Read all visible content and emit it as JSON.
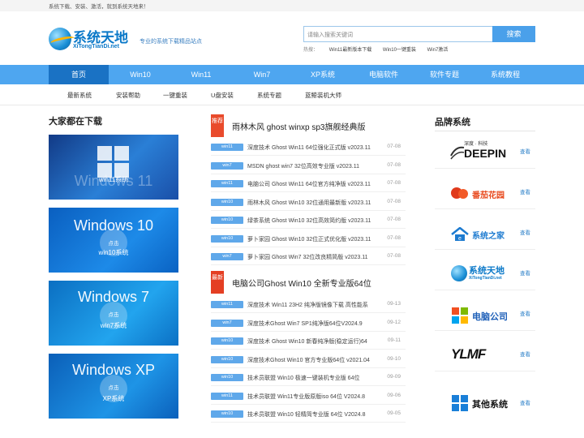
{
  "topbar": {
    "text": "系统下载、安装、激活，就到系统天地来！"
  },
  "header": {
    "logo_cn": "系统天地",
    "logo_en": "XiTongTianDi.net",
    "slogan": "专业的系统下载精品站点",
    "search_placeholder": "请输入搜索关键词",
    "search_button": "搜索",
    "hot_label": "热搜：",
    "hot_links": [
      "Win11最新版本下载",
      "Win10一键重装",
      "Win7激活"
    ]
  },
  "nav": {
    "items": [
      "首页",
      "Win10",
      "Win11",
      "Win7",
      "XP系统",
      "电脑软件",
      "软件专题",
      "系统教程"
    ]
  },
  "subnav": {
    "items": [
      "最新系统",
      "安装帮助",
      "一键重装",
      "U盘安装",
      "系统专题",
      "蓝鲸装机大师"
    ]
  },
  "left": {
    "title": "大家都在下载",
    "cards": [
      {
        "big": "Windows 11",
        "label": "win11系统"
      },
      {
        "big": "Windows 10",
        "label": "win10系统",
        "circle": "点击"
      },
      {
        "big": "Windows 7",
        "label": "win7系统",
        "circle": "点击"
      },
      {
        "big": "Windows XP",
        "label": "XP系统",
        "circle": "点击"
      }
    ]
  },
  "middle": {
    "groups": [
      {
        "badge": "推荐",
        "title": "雨林木风 ghost winxp sp3旗舰经典版",
        "rows": [
          {
            "tag": "win11",
            "title": "深度技术 Ghost Win11 64位强化正式版 v2023.11",
            "date": "07-08"
          },
          {
            "tag": "win7",
            "title": "MSDN ghost win7 32位高效专业版 v2023.11",
            "date": "07-08"
          },
          {
            "tag": "win11",
            "title": "电脑公司 Ghost Win11 64位官方纯净版 v2023.11",
            "date": "07-08"
          },
          {
            "tag": "win10",
            "title": "雨林木风 Ghost Win10 32位通用最新版 v2023.11",
            "date": "07-08"
          },
          {
            "tag": "win10",
            "title": "绿茶系统 Ghost Win10 32位高效简约版 v2023.11",
            "date": "07-08"
          },
          {
            "tag": "win10",
            "title": "萝卜家园 Ghost Win10 32位正式优化版 v2023.11",
            "date": "07-08"
          },
          {
            "tag": "win7",
            "title": "萝卜家园 Ghost Win7 32位改良精简版 v2023.11",
            "date": "07-08"
          }
        ]
      },
      {
        "badge": "最新",
        "title": "电脑公司Ghost Win10 全新专业版64位",
        "rows": [
          {
            "tag": "win11",
            "title": "深度技术 Win11 23H2 纯净版镜像下载 高性能系",
            "date": "09-13"
          },
          {
            "tag": "win7",
            "title": "深度技术Ghost Win7 SP1纯净版64位V2024.9",
            "date": "09-12"
          },
          {
            "tag": "win10",
            "title": "深度技术 Ghost Win10 新春纯净版(稳定运行)64",
            "date": "09-11"
          },
          {
            "tag": "win10",
            "title": "深度技术Ghost Win10 官方专业版64位 v2021.04",
            "date": "09-10"
          },
          {
            "tag": "win10",
            "title": "技术员联盟 Win10 极速一键装机专业版 64位",
            "date": "09-09"
          },
          {
            "tag": "win11",
            "title": "技术员联盟 Win11专业版原版iso 64位 V2024.8",
            "date": "09-06"
          },
          {
            "tag": "win10",
            "title": "技术员联盟 Win10 轻精简专业版 64位 V2024.8",
            "date": "09-05"
          }
        ]
      }
    ]
  },
  "right": {
    "title": "品牌系统",
    "brands": [
      {
        "name": "DEEPIN",
        "sub": "深度 · 科技",
        "look": "查看"
      },
      {
        "name": "番茄花园",
        "look": "查看"
      },
      {
        "name": "系统之家",
        "look": "查看"
      },
      {
        "name": "系统天地",
        "sub": "XiTongTianDi.net",
        "look": "查看"
      },
      {
        "name": "电脑公司",
        "look": "查看"
      },
      {
        "name": "YLMF",
        "look": "查看"
      },
      {
        "name": "其他系统",
        "look": "查看"
      }
    ]
  },
  "colors": {
    "nav_bg": "#4ea6f0",
    "nav_active": "#1a72c4",
    "tag_bg": "#5fa8ea",
    "badge_red": "#e94b2c"
  }
}
